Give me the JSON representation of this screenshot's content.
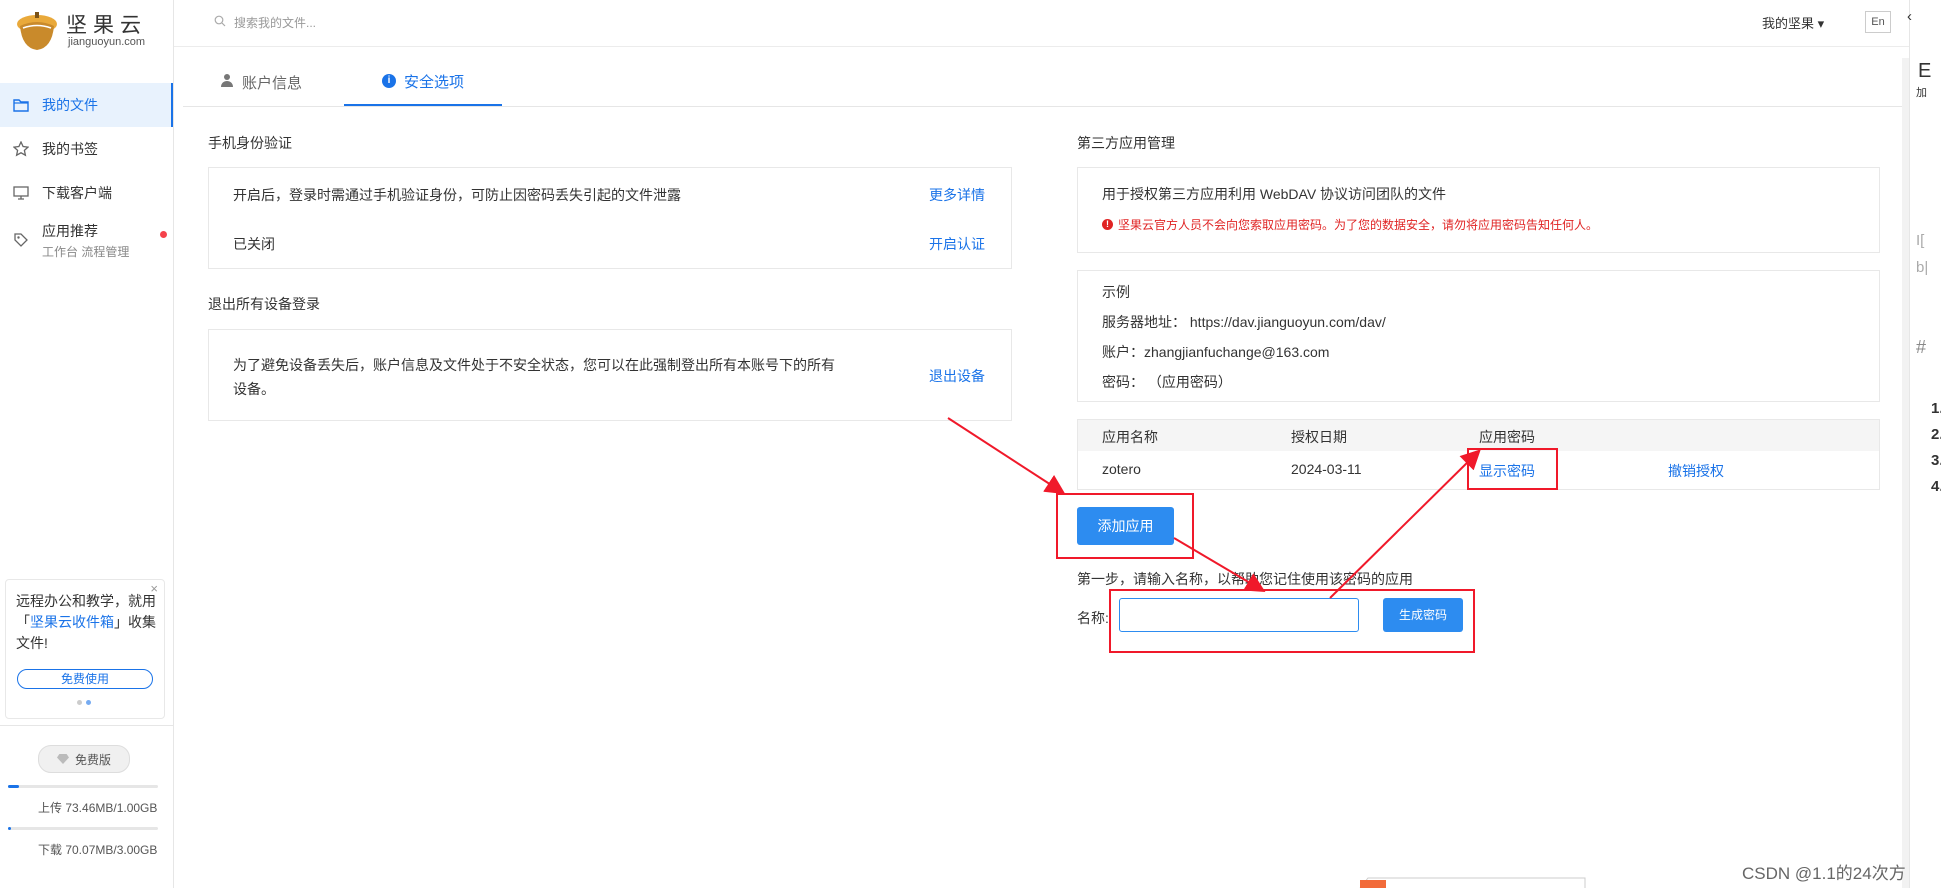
{
  "app": {
    "logo_main": "坚果云",
    "logo_sub": "jianguoyun.com"
  },
  "sidebar": {
    "items": [
      {
        "label": "我的文件",
        "icon": "folder-icon"
      },
      {
        "label": "我的书签",
        "icon": "star-icon"
      },
      {
        "label": "下载客户端",
        "icon": "monitor-icon"
      },
      {
        "label": "应用推荐",
        "sub": "工作台 流程管理",
        "icon": "tag-icon"
      }
    ],
    "promo": {
      "text_before": "远程办公和教学，就用「",
      "link": "坚果云收件箱",
      "text_after": "」收集文件!",
      "button": "免费使用",
      "close": "×"
    },
    "plan": "免费版",
    "upload_label": "上传 73.46MB/1.00GB",
    "upload_fraction": 0.0717,
    "download_label": "下载 70.07MB/3.00GB",
    "download_fraction": 0.0228
  },
  "topbar": {
    "search_placeholder": "搜索我的文件...",
    "user_menu": "我的坚果 ▾",
    "lang": "En"
  },
  "tabs": [
    {
      "label": "账户信息",
      "icon": "user-icon"
    },
    {
      "label": "安全选项",
      "icon": "info-icon"
    }
  ],
  "phone_verify": {
    "title": "手机身份验证",
    "description": "开启后，登录时需通过手机验证身份，可防止因密码丢失引起的文件泄露",
    "more": "更多详情",
    "status": "已关闭",
    "enable": "开启认证"
  },
  "logout_all": {
    "title": "退出所有设备登录",
    "description": "为了避免设备丢失后，账户信息及文件处于不安全状态，您可以在此强制登出所有本账号下的所有设备。",
    "action": "退出设备"
  },
  "third_party": {
    "title": "第三方应用管理",
    "description": "用于授权第三方应用利用 WebDAV 协议访问团队的文件",
    "warning": "坚果云官方人员不会向您索取应用密码。为了您的数据安全，请勿将应用密码告知任何人。",
    "example": {
      "heading": "示例",
      "server": "服务器地址： https://dav.jianguoyun.com/dav/",
      "account": "账户：zhangjianfuchange@163.com",
      "password": "密码： （应用密码）"
    },
    "table": {
      "headers": [
        "应用名称",
        "授权日期",
        "应用密码"
      ],
      "rows": [
        {
          "name": "zotero",
          "date": "2024-03-11",
          "show": "显示密码",
          "revoke": "撤销授权"
        }
      ]
    },
    "add_button": "添加应用",
    "step_text": "第一步，请输入名称，以帮助您记住使用该密码的应用",
    "name_label": "名称:",
    "name_value": "",
    "generate_button": "生成密码"
  },
  "right_strip": {
    "glyphs": [
      "E",
      "加",
      "I[",
      "b|",
      "#",
      "1.",
      "2.",
      "3.",
      "4."
    ]
  },
  "watermark": "CSDN @1.1的24次方",
  "colors": {
    "accent": "#1a73e8",
    "warning": "#e02424",
    "annotation": "#f0192a"
  }
}
